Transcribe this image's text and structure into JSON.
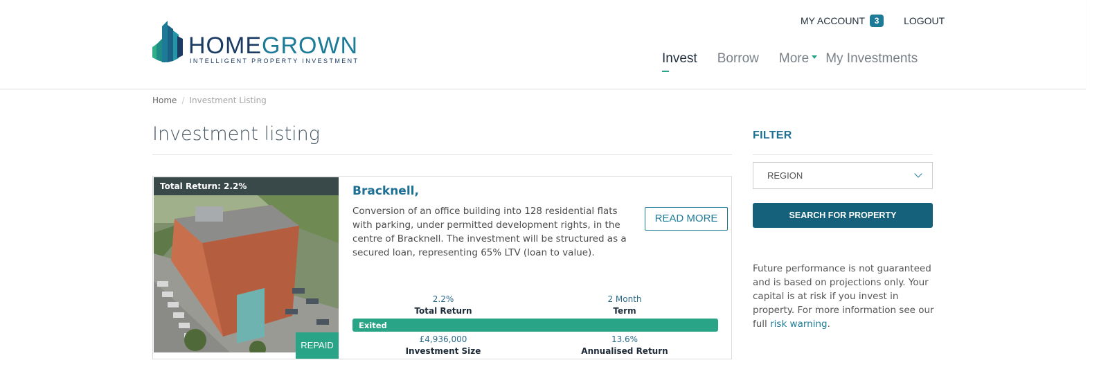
{
  "brand": {
    "name_part1": "HOME",
    "name_part2": "GROWN",
    "tagline": "INTELLIGENT PROPERTY INVESTMENT",
    "colors": {
      "navy": "#1b3b63",
      "teal": "#1d7b98",
      "green": "#29a486"
    }
  },
  "topnav": {
    "my_account": "MY ACCOUNT",
    "account_badge": "3",
    "logout": "LOGOUT"
  },
  "mainnav": {
    "items": [
      "Invest",
      "Borrow",
      "More",
      "My Investments"
    ],
    "active": "Invest"
  },
  "breadcrumb": {
    "home": "Home",
    "separator": "/",
    "current": "Investment Listing"
  },
  "page_title": "Investment listing",
  "listing": {
    "total_return_banner": "Total Return: 2.2%",
    "status_badge": "REPAID",
    "title": "Bracknell,",
    "description": "Conversion of an office building into 128 residential flats with parking, under permitted development rights, in the centre of Bracknell. The investment will be structured as a secured loan, representing 65% LTV (loan to value).",
    "read_more": "READ MORE",
    "stats": {
      "total_return": {
        "value": "2.2%",
        "label": "Total Return"
      },
      "term": {
        "value": "2 Month",
        "label": "Term"
      },
      "investment_size": {
        "value": "£4,936,000",
        "label": "Investment Size"
      },
      "annualised_return": {
        "value": "13.6%",
        "label": "Annualised Return"
      }
    },
    "progress": {
      "label": "Exited",
      "fraction": 1.0
    }
  },
  "sidebar": {
    "filter_title": "FILTER",
    "region_placeholder": "REGION",
    "search_button": "SEARCH FOR PROPERTY",
    "disclaimer_text": "Future performance is not guaranteed and is based on projections only. Your capital is at risk if you invest in property. For more information see our full ",
    "disclaimer_link": "risk warning",
    "disclaimer_end": "."
  }
}
